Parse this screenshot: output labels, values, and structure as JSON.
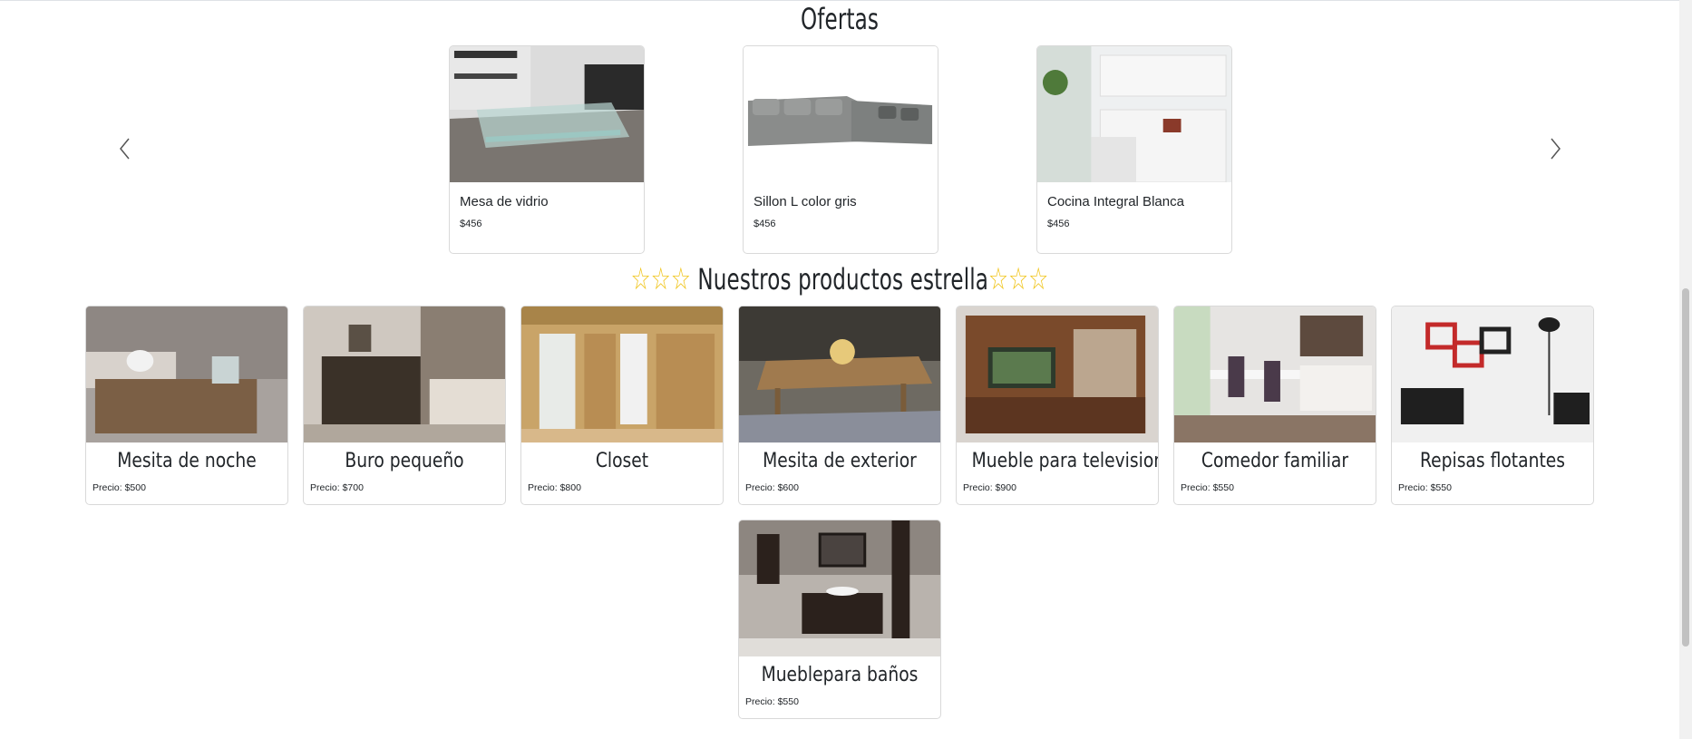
{
  "ofertas": {
    "title": "Ofertas",
    "items": [
      {
        "name": "Mesa de vidrio",
        "price": "$456"
      },
      {
        "name": "Sillon L color gris",
        "price": "$456"
      },
      {
        "name": "Cocina Integral Blanca",
        "price": "$456"
      }
    ]
  },
  "estrella": {
    "stars_left": "☆☆☆",
    "title": "Nuestros productos estrella",
    "stars_right": "☆☆☆",
    "items": [
      {
        "name": "Mesita de noche",
        "price": "Precio: $500"
      },
      {
        "name": "Buro pequeño",
        "price": "Precio: $700"
      },
      {
        "name": "Closet",
        "price": "Precio: $800"
      },
      {
        "name": "Mesita de exterior",
        "price": "Precio: $600"
      },
      {
        "name": "Mueble para television",
        "price": "Precio: $900"
      },
      {
        "name": "Comedor familiar",
        "price": "Precio: $550"
      },
      {
        "name": "Repisas flotantes",
        "price": "Precio: $550"
      },
      {
        "name": "Mueblepara baños",
        "price": "Precio: $550"
      }
    ]
  },
  "icons": {
    "prev": "chevron-left-icon",
    "next": "chevron-right-icon"
  },
  "colors": {
    "star": "#f0c419",
    "border": "#d9d9d9"
  }
}
